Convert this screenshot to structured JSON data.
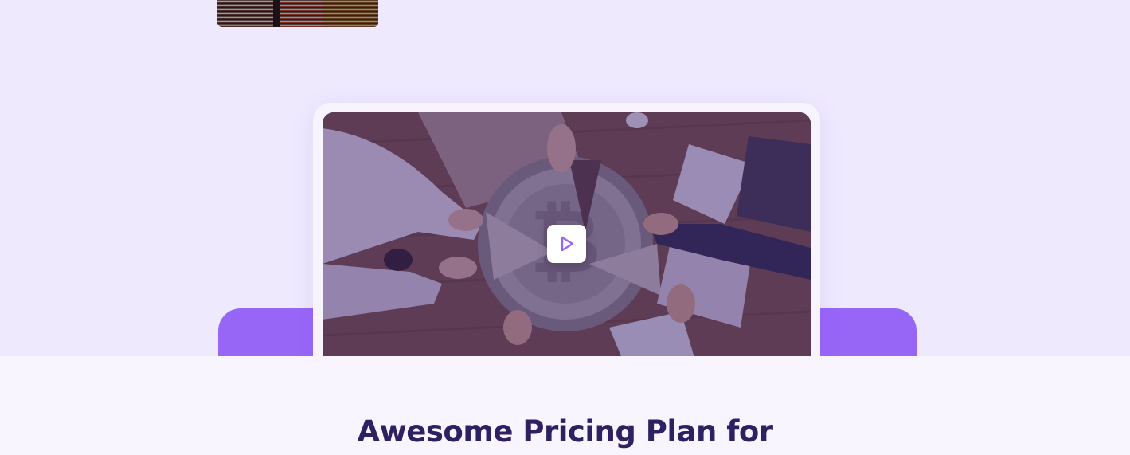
{
  "top_image": {
    "icon": "coin-stacks-image"
  },
  "video": {
    "icon": "play-icon",
    "image": "bitcoin-team-image",
    "accent_color": "#9866f7",
    "overlay_color": "#3c1e6e"
  },
  "pricing": {
    "title": "Awesome Pricing Plan for",
    "title_color": "#2f2061"
  },
  "colors": {
    "page_bg": "#efe9fe",
    "section_bg": "#f8f5fe",
    "band": "#9866f7"
  }
}
